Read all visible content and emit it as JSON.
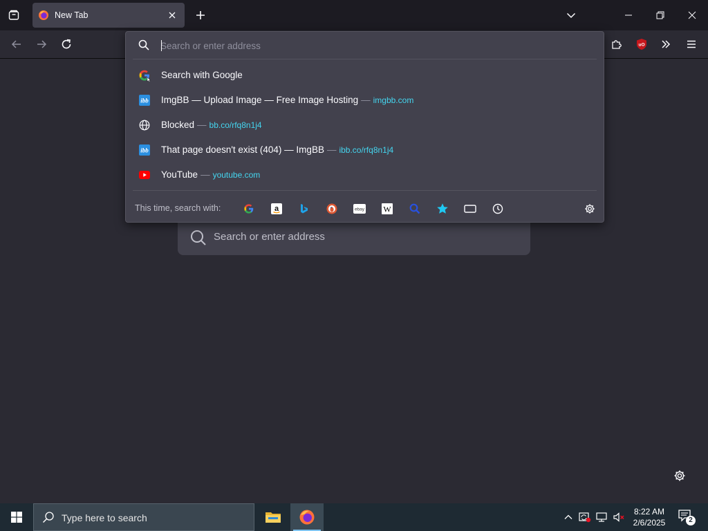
{
  "titlebar": {
    "tab": {
      "title": "New Tab"
    }
  },
  "urlbar": {
    "placeholder": "Search or enter address",
    "results": [
      {
        "icon": "google-icon",
        "title": "Search with Google",
        "url": ""
      },
      {
        "icon": "imgbb-icon",
        "title": "ImgBB — Upload Image — Free Image Hosting",
        "url": "imgbb.com"
      },
      {
        "icon": "globe-icon",
        "title": "Blocked",
        "url": "bb.co/rfq8n1j4"
      },
      {
        "icon": "imgbb-icon",
        "title": "That page doesn't exist (404) — ImgBB",
        "url": "ibb.co/rfq8n1j4"
      },
      {
        "icon": "youtube-icon",
        "title": "YouTube",
        "url": "youtube.com"
      }
    ],
    "separator": "—",
    "imgbb_mark": "ibb",
    "oneoff_label": "This time, search with:",
    "engines": [
      "google",
      "amazon",
      "bing",
      "duckduckgo",
      "ebay",
      "wikipedia",
      "search",
      "bookmarks",
      "tabs",
      "history"
    ],
    "engine_marks": {
      "amazon": "a",
      "bing": "b",
      "ebay": "ebay",
      "wikipedia": "W"
    }
  },
  "page": {
    "search_placeholder": "Search or enter address"
  },
  "taskbar": {
    "search_placeholder": "Type here to search",
    "time": "8:22 AM",
    "date": "2/6/2025",
    "notification_count": "2"
  },
  "colors": {
    "accent_url": "#45d6f0",
    "chrome_bg": "#1c1b22",
    "toolbar_bg": "#2b2a33",
    "panel_bg": "#42414d"
  }
}
